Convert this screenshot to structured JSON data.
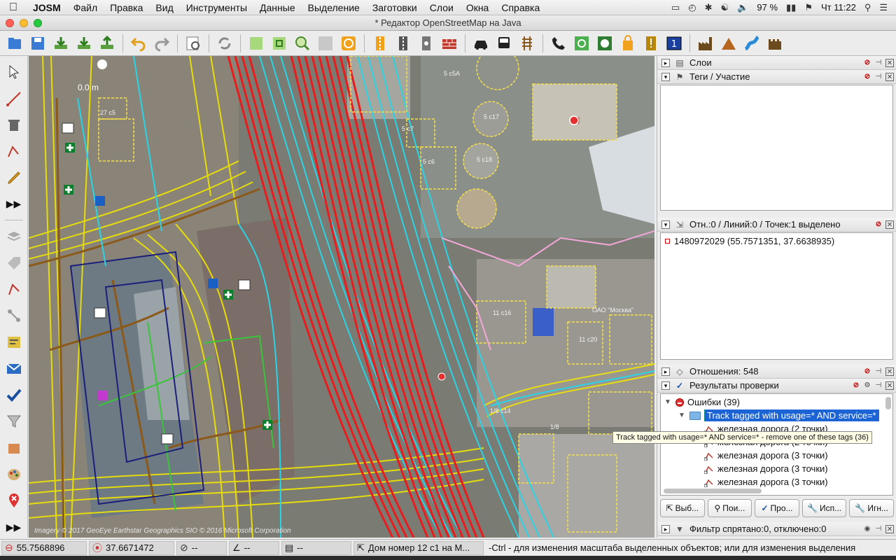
{
  "menubar": {
    "app_name": "JOSM",
    "menus": [
      "Файл",
      "Правка",
      "Вид",
      "Инструменты",
      "Данные",
      "Выделение",
      "Заготовки",
      "Слои",
      "Окна",
      "Справка"
    ],
    "battery": "97 %",
    "clock": "Чт 11:22"
  },
  "window": {
    "title": "* Редактор OpenStreetMap на Java"
  },
  "map": {
    "scale_label": "0.0 m",
    "attribution": "Imagery © 2017 GeoEye Earthstar Geographics  SIO © 2016 Microsoft Corporation",
    "labels": {
      "l1": "5 c5A",
      "l2": "5 c17",
      "l3": "5 c7",
      "l4": "5 c6",
      "l5": "5 c18",
      "l6": "11 c16",
      "l7": "ОАО \"Москва\"",
      "l8": "11 c20",
      "l9": "1/8 c14",
      "l10": "1/8",
      "l11": "27 c5"
    }
  },
  "panels": {
    "layers": {
      "title": "Слои"
    },
    "tags": {
      "title": "Теги / Участие"
    },
    "selection": {
      "title": "Отн.:0 / Линий:0 / Точек:1 выделено",
      "item": "1480972029 (55.7571351, 37.6638935)"
    },
    "relations": {
      "title": "Отношения: 548"
    },
    "validation": {
      "title": "Результаты проверки",
      "errors_label": "Ошибки (39)",
      "selected_group": "Track tagged with usage=* AND service=*",
      "items": [
        "железная дорога (2 точки)",
        "железная дорога (2 точки)",
        "железная дорога (3 точки)",
        "железная дорога (3 точки)",
        "железная дорога (3 точки)"
      ],
      "tooltip": "Track tagged with usage=* AND service=* - remove one of these tags (36)",
      "buttons": [
        "Выб...",
        "Пои...",
        "Про...",
        "Исп...",
        "Игн..."
      ]
    },
    "filter": {
      "title": "Фильтр спрятано:0, отключено:0"
    }
  },
  "status": {
    "lat": "55.7568896",
    "lon": "37.6671472",
    "heading": "--",
    "angle": "--",
    "length": "--",
    "name": "Дом номер 12 c1 на М...",
    "message": "-Ctrl - для изменения масштаба выделенных объектов; или для изменения выделения"
  },
  "colors": {
    "rail": "#e81c1c",
    "highway": "#f2e600",
    "service": "#29d4e6",
    "building": "#f5e04b",
    "selection_blue": "#1c64d6"
  }
}
